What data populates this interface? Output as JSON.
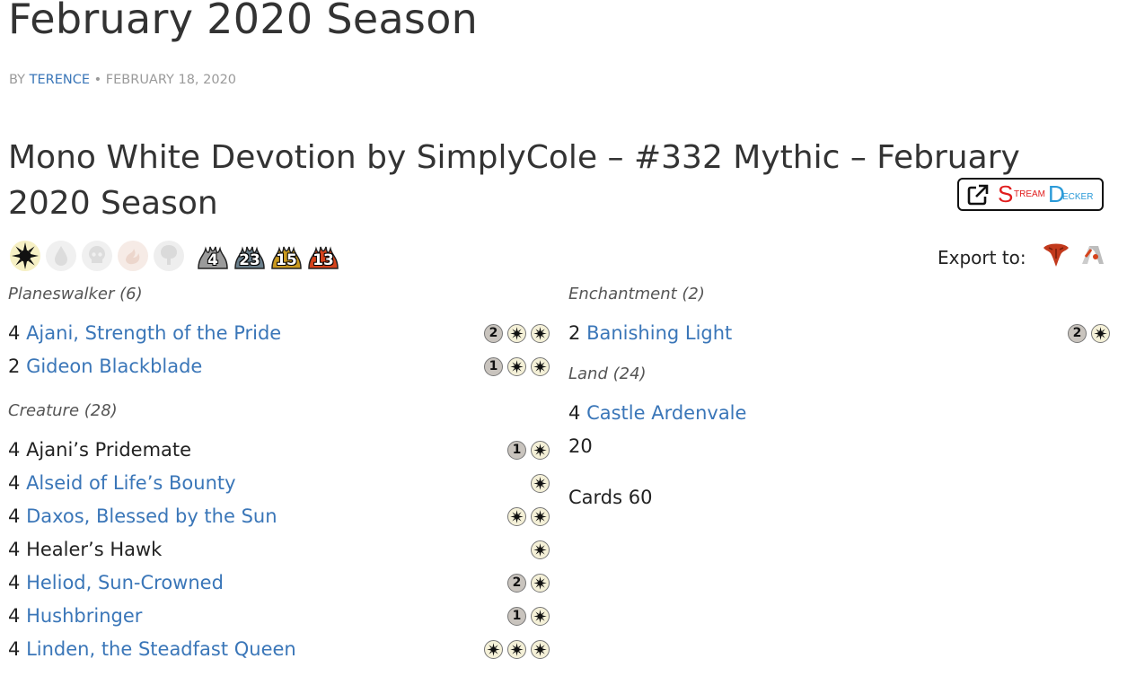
{
  "post": {
    "title": "February 2020 Season",
    "byline_prefix": "BY",
    "author": "TERENCE",
    "separator": "•",
    "date": "FEBRUARY 18, 2020"
  },
  "deck": {
    "title": "Mono White Devotion by SimplyCole – #332 Mythic – February 2020 Season",
    "colors": [
      {
        "name": "white",
        "active": true,
        "icon": "white-mana-icon"
      },
      {
        "name": "blue",
        "active": false,
        "icon": "blue-mana-icon"
      },
      {
        "name": "black",
        "active": false,
        "icon": "black-mana-icon"
      },
      {
        "name": "red",
        "active": false,
        "icon": "red-mana-icon"
      },
      {
        "name": "green",
        "active": false,
        "icon": "green-mana-icon"
      }
    ],
    "rarities": [
      {
        "name": "common",
        "count": "4",
        "color": "#9b9b9b"
      },
      {
        "name": "uncommon",
        "count": "23",
        "color": "#6a7f8c"
      },
      {
        "name": "rare",
        "count": "15",
        "color": "#c9991e"
      },
      {
        "name": "mythic",
        "count": "13",
        "color": "#d6431c"
      }
    ]
  },
  "streamdecker": {
    "icon": "external-link-icon",
    "logo_s": "S",
    "logo_tream": "TREAM",
    "logo_d": "D",
    "logo_ecker": "ECKER"
  },
  "export": {
    "label": "Export to:",
    "targets": [
      "mtga-icon",
      "mtgo-icon"
    ]
  },
  "groups_left": [
    {
      "header": "Planeswalker (6)",
      "cards": [
        {
          "qty": "4",
          "name": "Ajani, Strength of the Pride",
          "link": true,
          "cost": [
            "2",
            "W",
            "W"
          ]
        },
        {
          "qty": "2",
          "name": "Gideon Blackblade",
          "link": true,
          "cost": [
            "1",
            "W",
            "W"
          ]
        }
      ]
    },
    {
      "header": "Creature (28)",
      "cards": [
        {
          "qty": "4",
          "name": "Ajani’s Pridemate",
          "link": false,
          "cost": [
            "1",
            "W"
          ]
        },
        {
          "qty": "4",
          "name": "Alseid of Life’s Bounty",
          "link": true,
          "cost": [
            "W"
          ]
        },
        {
          "qty": "4",
          "name": "Daxos, Blessed by the Sun",
          "link": true,
          "cost": [
            "W",
            "W"
          ]
        },
        {
          "qty": "4",
          "name": "Healer’s Hawk",
          "link": false,
          "cost": [
            "W"
          ]
        },
        {
          "qty": "4",
          "name": "Heliod, Sun-Crowned",
          "link": true,
          "cost": [
            "2",
            "W"
          ]
        },
        {
          "qty": "4",
          "name": "Hushbringer",
          "link": true,
          "cost": [
            "1",
            "W"
          ]
        },
        {
          "qty": "4",
          "name": "Linden, the Steadfast Queen",
          "link": true,
          "cost": [
            "W",
            "W",
            "W"
          ]
        }
      ]
    }
  ],
  "groups_right": [
    {
      "header": "Enchantment (2)",
      "cards": [
        {
          "qty": "2",
          "name": "Banishing Light",
          "link": true,
          "cost": [
            "2",
            "W"
          ]
        }
      ]
    },
    {
      "header": "Land (24)",
      "cards": [
        {
          "qty": "4",
          "name": "Castle Ardenvale",
          "link": true,
          "cost": []
        }
      ]
    }
  ],
  "extra_land_line": "20",
  "cards_total": "Cards 60"
}
